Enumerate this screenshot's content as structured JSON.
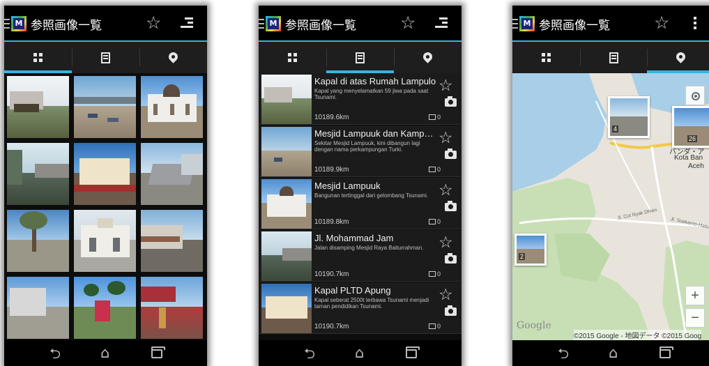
{
  "colors": {
    "accent": "#33b5e5",
    "actionbar": "#000000",
    "tabbar": "#1e1e1e",
    "list_bg": "#1b1b1b",
    "map_land": "#e8e4dc",
    "map_green": "#c8dfb6"
  },
  "app": {
    "title": "参照画像一覧",
    "logo_letter": "M"
  },
  "tabs": [
    {
      "icon": "grid-view-icon"
    },
    {
      "icon": "list-view-icon"
    },
    {
      "icon": "map-pin-icon"
    }
  ],
  "nav": {
    "back_icon": "back-icon",
    "home_icon": "home-icon",
    "recent_icon": "recent-apps-icon"
  },
  "icons": {
    "star": "☆",
    "back": "⮌",
    "home": "⌂"
  },
  "list": {
    "items": [
      {
        "title": "Kapal di atas Rumah Lampulo",
        "description": "Kapal yang menyelamatkan 59 jiwa pada saat Tsunami.",
        "distance": "10189.6km",
        "count": "0"
      },
      {
        "title": "Mesjid Lampuuk dan Kampong...",
        "description": "Sekitar Mesjid Lampuuk, kini dibangun lagi dengan nama perkampungan Turki.",
        "distance": "10189.9km",
        "count": "0"
      },
      {
        "title": "Mesjid Lampuuk",
        "description": "Bangunan tertinggal dari gelombang Tsunami.",
        "distance": "10189.8km",
        "count": "0"
      },
      {
        "title": "Jl. Mohammad Jam",
        "description": "Jalan disamping Mesjid Raya Baiturrahman.",
        "distance": "10190.7km",
        "count": "0"
      },
      {
        "title": "Kapal PLTD Apung",
        "description": "Kapal seberat 2500t terbawa Tsunami menjadi taman pendidikan Tsunami.",
        "distance": "10190.7km",
        "count": "0"
      }
    ]
  },
  "map": {
    "markers": [
      {
        "count": "4"
      },
      {
        "count": "26"
      },
      {
        "count": "2"
      }
    ],
    "labels": {
      "city_jp": "バンダ・ア",
      "city_1": "Kota Ban",
      "city_2": "Aceh",
      "road_1": "Jl. Cut Nyak Dhien",
      "road_2": "Jl. Soekarno-Hatta"
    },
    "zoom_in": "+",
    "zoom_out": "−",
    "google_logo": "Google",
    "attribution": "©2015 Google - 地図データ ©2015 Goog"
  }
}
